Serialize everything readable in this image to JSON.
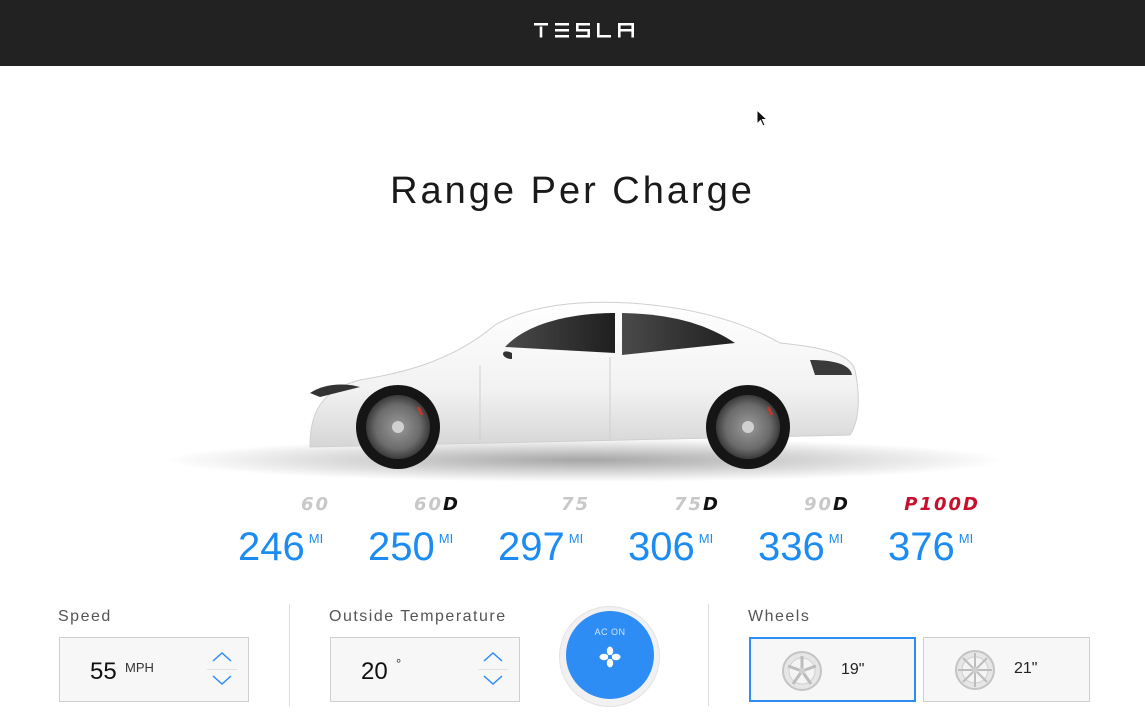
{
  "header": {
    "brand": "TESLA"
  },
  "main": {
    "title": "Range Per Charge"
  },
  "models": [
    {
      "name": "60",
      "suffix": "",
      "prefix": "",
      "range": "246",
      "unit": "MI"
    },
    {
      "name": "60",
      "suffix": "D",
      "prefix": "",
      "range": "250",
      "unit": "MI"
    },
    {
      "name": "75",
      "suffix": "",
      "prefix": "",
      "range": "297",
      "unit": "MI"
    },
    {
      "name": "75",
      "suffix": "D",
      "prefix": "",
      "range": "306",
      "unit": "MI"
    },
    {
      "name": "90",
      "suffix": "D",
      "prefix": "",
      "range": "336",
      "unit": "MI"
    },
    {
      "name": "100",
      "suffix": "D",
      "prefix": "P",
      "range": "376",
      "unit": "MI"
    }
  ],
  "controls": {
    "speed": {
      "label": "Speed",
      "value": "55",
      "unit": "MPH"
    },
    "temperature": {
      "label": "Outside Temperature",
      "value": "20",
      "unit": "°"
    },
    "ac": {
      "label": "AC ON",
      "icon": "fan-icon"
    },
    "wheels": {
      "label": "Wheels",
      "options": [
        {
          "size": "19\"",
          "selected": true
        },
        {
          "size": "21\"",
          "selected": false
        }
      ]
    }
  },
  "colors": {
    "accent": "#2e8df5",
    "range_text": "#1c8cf2",
    "header_bg": "#222222",
    "performance_red": "#c8102e"
  }
}
